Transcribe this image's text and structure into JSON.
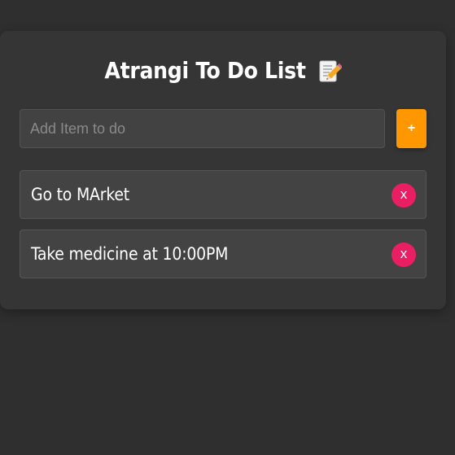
{
  "app": {
    "title": "Atrangi To Do List",
    "title_icon": "memo-icon"
  },
  "form": {
    "placeholder": "Add Item to do",
    "value": "",
    "add_label": "+"
  },
  "todos": [
    {
      "text": "Go to MArket",
      "delete_label": "x"
    },
    {
      "text": "Take medicine at 10:00PM",
      "delete_label": "x"
    }
  ],
  "colors": {
    "background": "#2f2f2f",
    "card": "#353535",
    "input": "#424242",
    "item": "#434343",
    "add_button": "#ff9800",
    "delete_button": "#e91e63",
    "text": "#ffffff"
  }
}
